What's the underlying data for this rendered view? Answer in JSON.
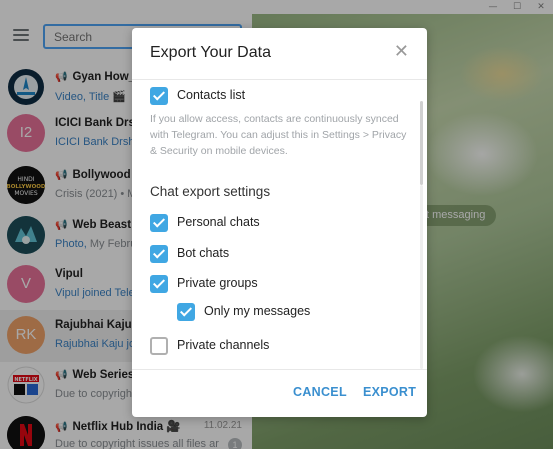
{
  "window": {
    "minimize": "—",
    "maximize": "☐",
    "close": "✕"
  },
  "sidebar": {
    "search_placeholder": "Search",
    "chats": [
      {
        "title": "Gyan How_t",
        "channel": true,
        "snippet_hl": "Video, Title 🎬",
        "snippet": "",
        "avatar_color": "#ffffff",
        "avatar_text": ""
      },
      {
        "title": "ICICI Bank Drsh",
        "channel": false,
        "snippet_hl": "ICICI Bank Drsh",
        "snippet": "",
        "avatar_color": "#e9739a",
        "avatar_text": "I2"
      },
      {
        "title": "Bollywood H",
        "channel": true,
        "snippet_hl": "",
        "snippet": "Crisis (2021) • M",
        "avatar_color": "#111111",
        "avatar_text": ""
      },
      {
        "title": "Web Beast",
        "channel": true,
        "snippet_hl": "Photo,",
        "snippet": " My Febru",
        "avatar_color": "#2b6b78",
        "avatar_text": ""
      },
      {
        "title": "Vipul",
        "channel": false,
        "snippet_hl": "Vipul joined Tele",
        "snippet": "",
        "avatar_color": "#e9739a",
        "avatar_text": "V"
      },
      {
        "title": "Rajubhai Kaju",
        "channel": false,
        "snippet_hl": "Rajubhai Kaju jo",
        "snippet": "",
        "avatar_color": "#f0a36a",
        "avatar_text": "RK"
      },
      {
        "title": "Web Series H",
        "channel": true,
        "snippet_hl": "",
        "snippet": "Due to copyrigh",
        "avatar_color": "#ffffff",
        "avatar_text": ""
      },
      {
        "title": "Netflix Hub India 🎥",
        "channel": true,
        "snippet_hl": "",
        "snippet": "Due to copyright issues all files ar",
        "avatar_color": "#111111",
        "avatar_text": "",
        "time": "11.02.21",
        "badge": "1"
      }
    ]
  },
  "background": {
    "hint": "t messaging"
  },
  "dialog": {
    "title": "Export Your Data",
    "close_icon": "✕",
    "contacts_label": "Contacts list",
    "contacts_checked": true,
    "note": "If you allow access, contacts are continuously synced with Telegram. You can adjust this in Settings > Privacy & Security on mobile devices.",
    "section_title": "Chat export settings",
    "options": [
      {
        "label": "Personal chats",
        "checked": true
      },
      {
        "label": "Bot chats",
        "checked": true
      },
      {
        "label": "Private groups",
        "checked": true
      },
      {
        "label": "Only my messages",
        "checked": true
      },
      {
        "label": "Private channels",
        "checked": false
      }
    ],
    "cancel_label": "CANCEL",
    "export_label": "EXPORT"
  }
}
